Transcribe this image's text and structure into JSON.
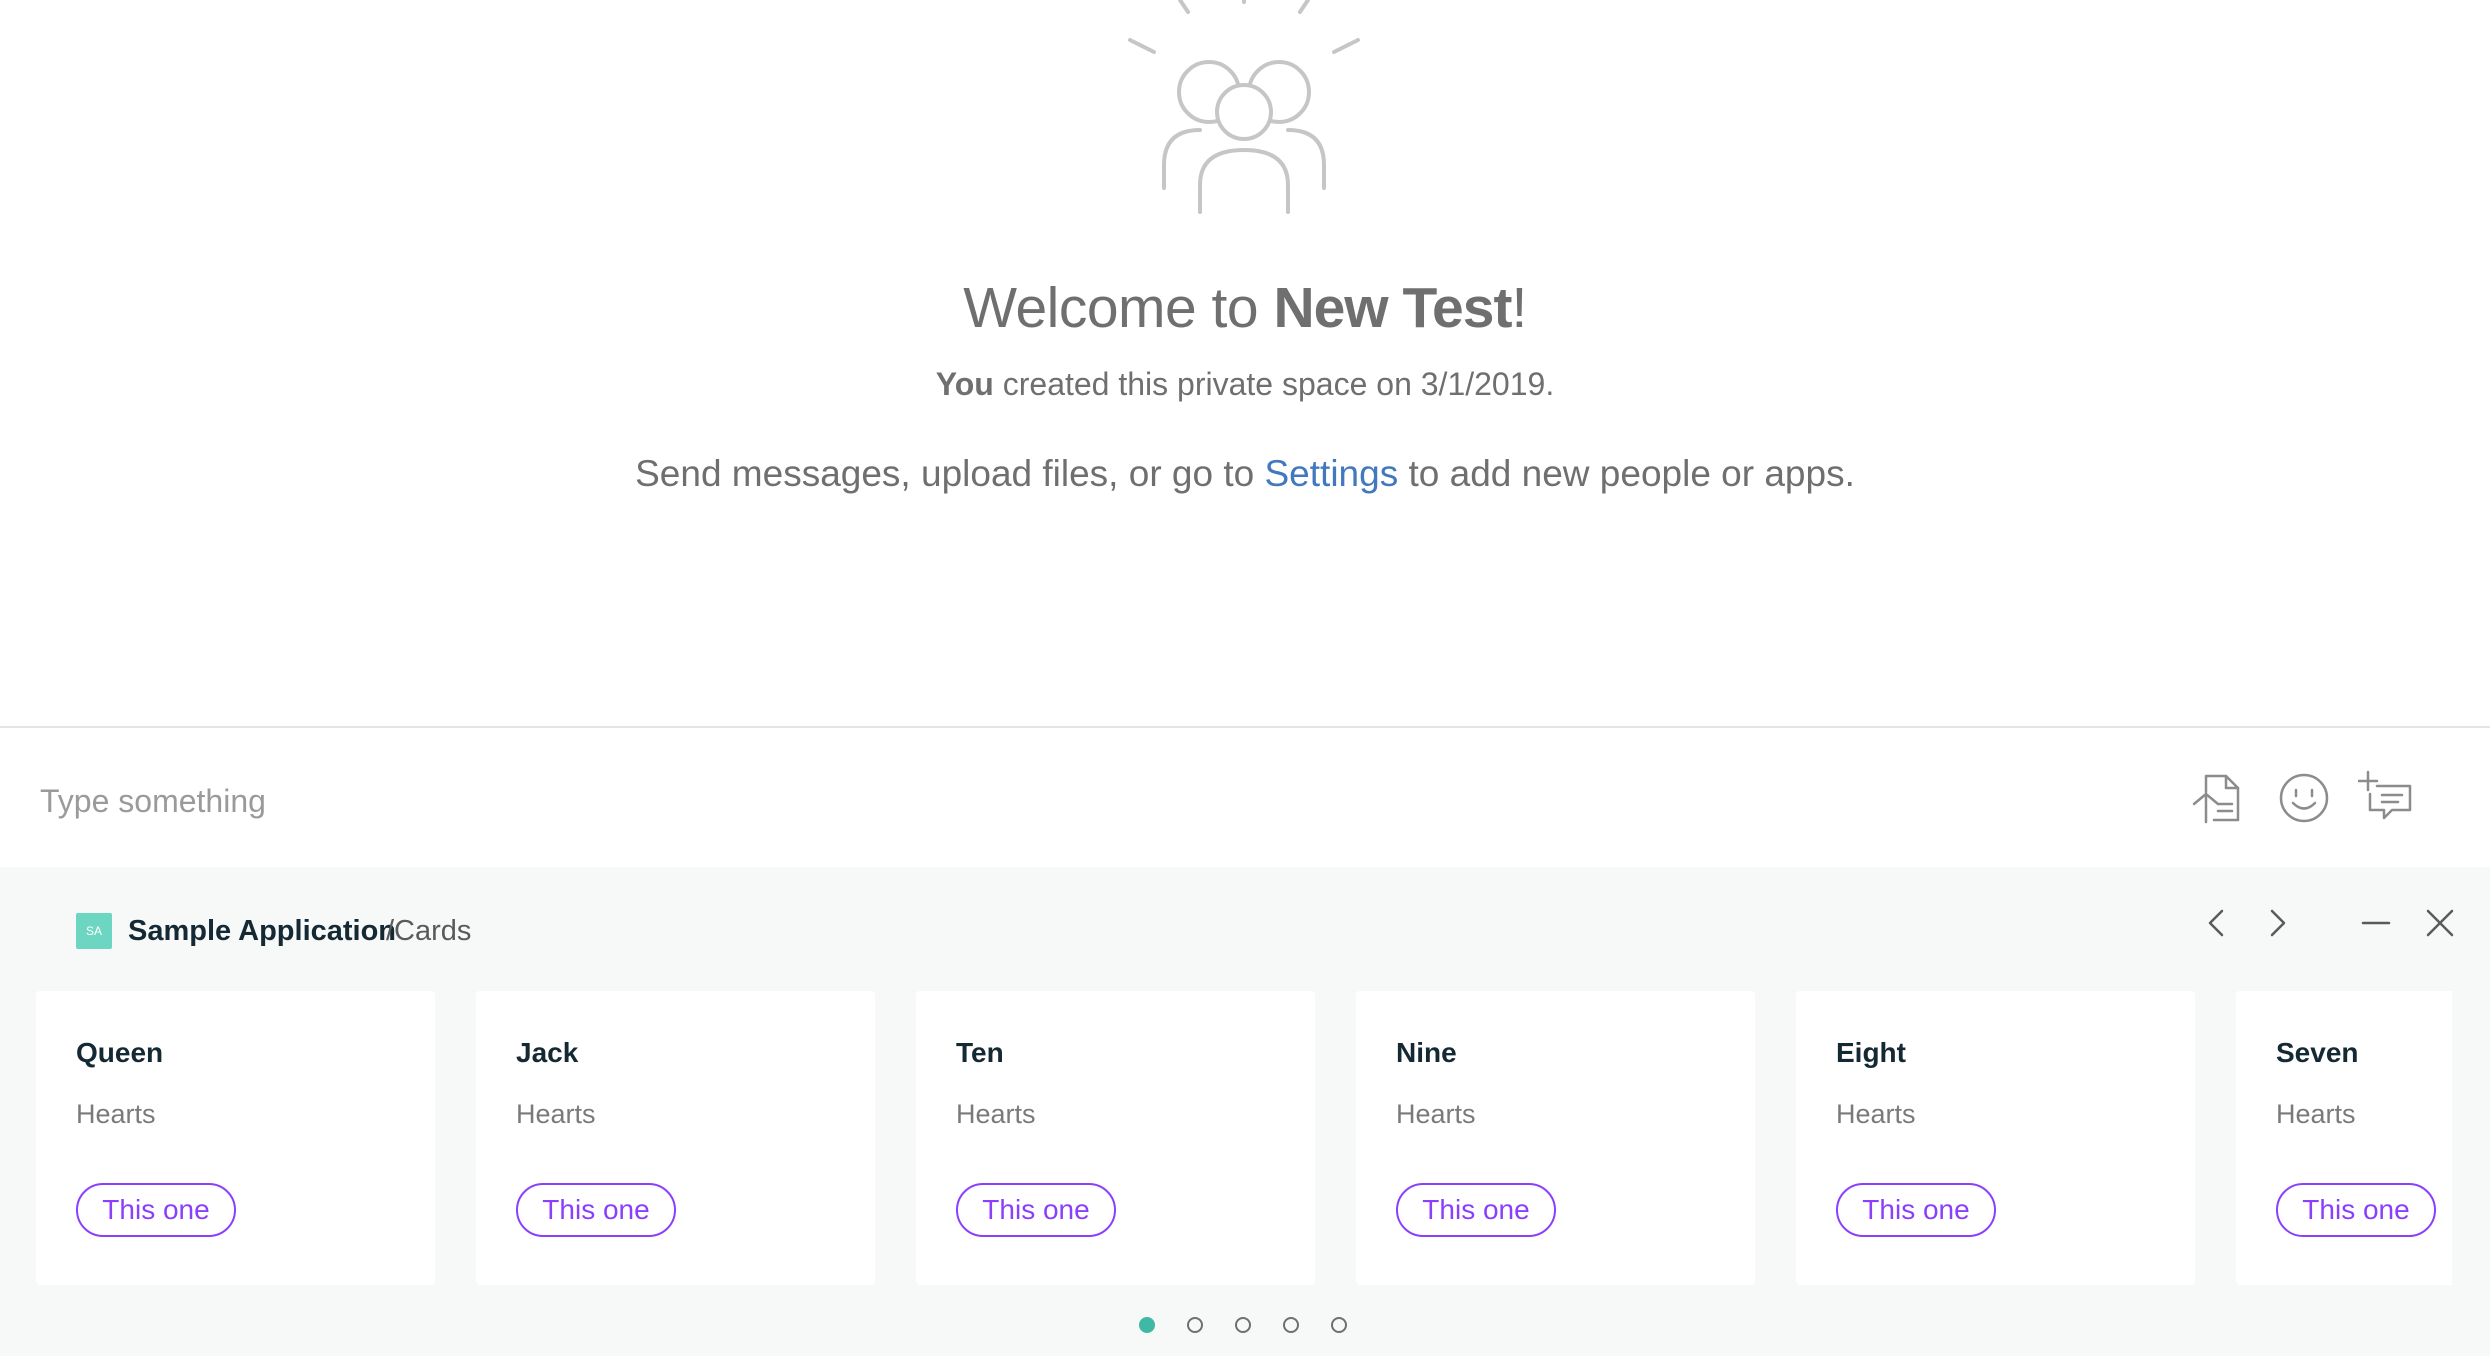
{
  "welcome": {
    "title_prefix": "Welcome to ",
    "space_name": "New Test",
    "title_suffix": "!",
    "created_by": "You",
    "created_text": " created this private space on 3/1/2019.",
    "instructions_prefix": "Send messages, upload files, or go to ",
    "settings_link": "Settings",
    "instructions_suffix": " to add new people or apps."
  },
  "composer": {
    "placeholder": "Type something",
    "icons": [
      "upload-file-icon",
      "emoji-icon",
      "add-action-icon"
    ]
  },
  "app_tray": {
    "badge": "SA",
    "app_name": "Sample Application",
    "path": "/Cards",
    "badge_color": "#6dd6c2",
    "cards": [
      {
        "title": "Queen",
        "subtitle": "Hearts",
        "button": "This one"
      },
      {
        "title": "Jack",
        "subtitle": "Hearts",
        "button": "This one"
      },
      {
        "title": "Ten",
        "subtitle": "Hearts",
        "button": "This one"
      },
      {
        "title": "Nine",
        "subtitle": "Hearts",
        "button": "This one"
      },
      {
        "title": "Eight",
        "subtitle": "Hearts",
        "button": "This one"
      },
      {
        "title": "Seven",
        "subtitle": "Hearts",
        "button": "This one"
      }
    ],
    "pagination": {
      "pages": 5,
      "current": 1
    }
  },
  "colors": {
    "accent_purple": "#8a3ffc",
    "link_blue": "#4178be",
    "active_dot": "#3fb8a5",
    "text_gray": "#6f6f6f"
  }
}
